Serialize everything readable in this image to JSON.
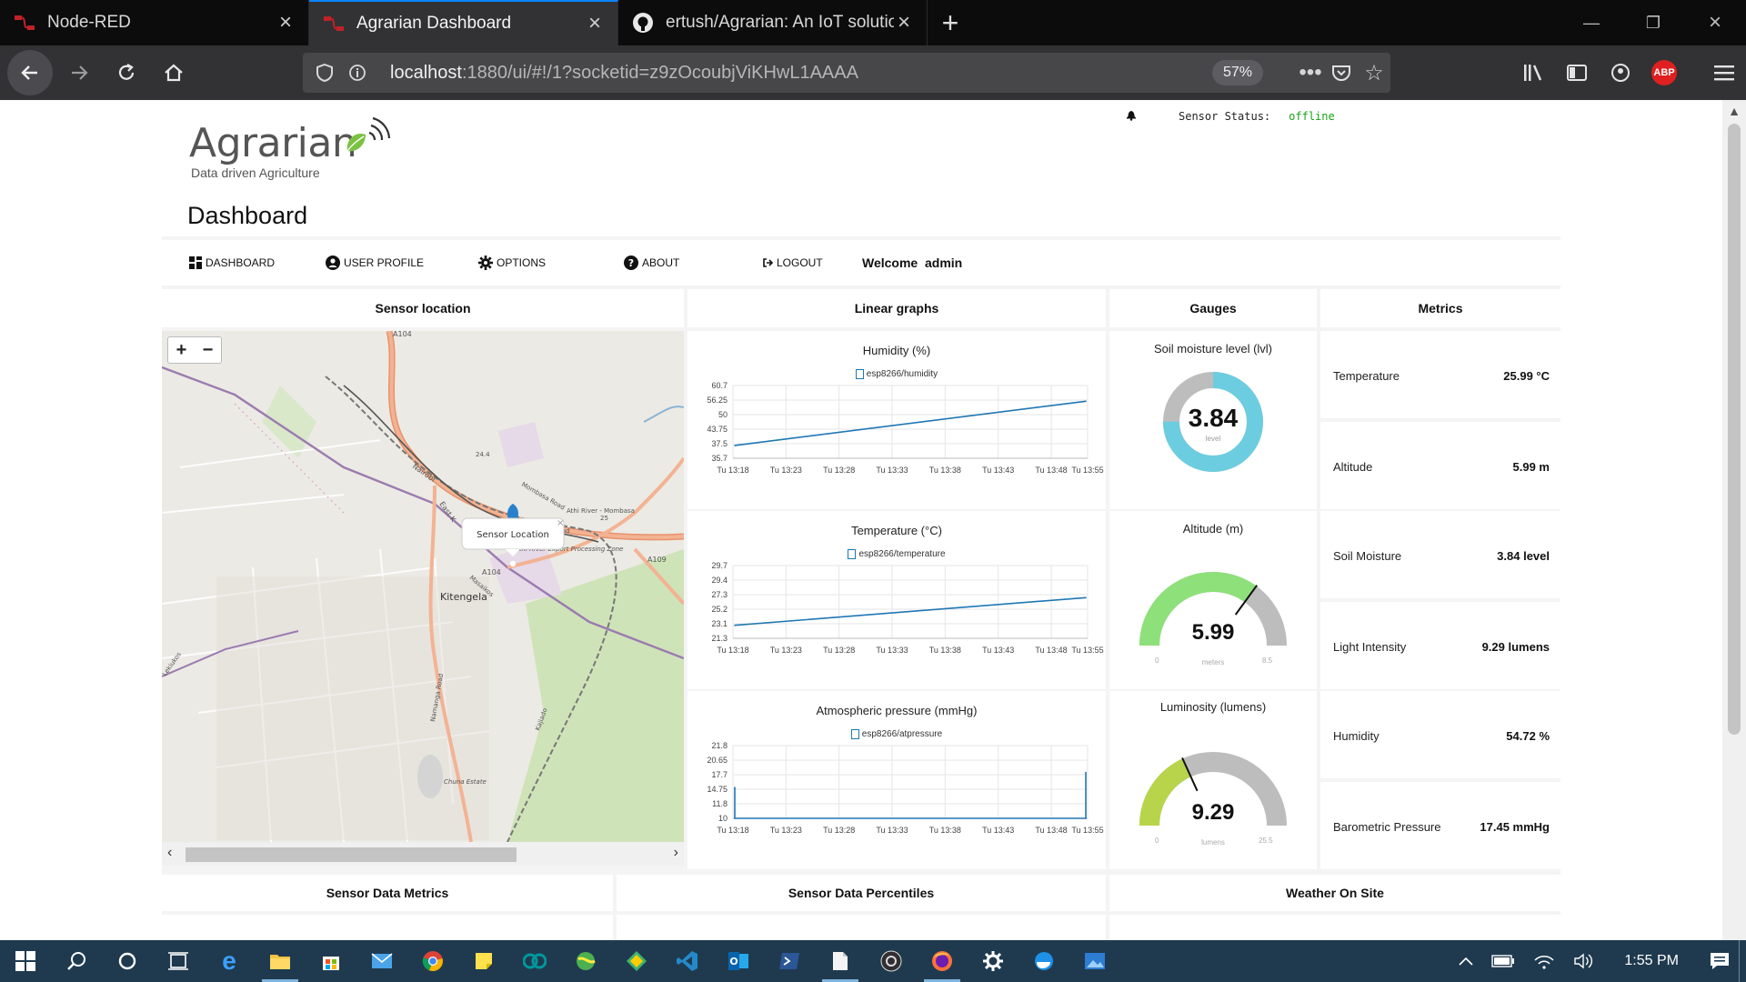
{
  "browser": {
    "tabs": [
      {
        "title": "Node-RED",
        "active": false
      },
      {
        "title": "Agrarian Dashboard",
        "active": true
      },
      {
        "title": "ertush/Agrarian: An IoT solutio",
        "active": false
      }
    ],
    "url_host": "localhost",
    "url_rest": ":1880/ui/#!/1?socketid=z9zOcoubjViKHwL1AAAA",
    "zoom": "57%"
  },
  "header": {
    "brand": "Agrarian",
    "tagline": "Data driven Agriculture",
    "page_title": "Dashboard",
    "status_label": "Sensor Status:",
    "status_value": "offline"
  },
  "menu": {
    "items": [
      "DASHBOARD",
      "USER PROFILE",
      "OPTIONS",
      "ABOUT",
      "LOGOUT"
    ],
    "welcome": "Welcome  admin"
  },
  "columns": {
    "map": "Sensor location",
    "graphs": "Linear graphs",
    "gauges": "Gauges",
    "metrics": "Metrics"
  },
  "bottom_columns": [
    "Sensor Data Metrics",
    "Sensor Data Percentiles",
    "Weather On Site"
  ],
  "map": {
    "popup": "Sensor Location",
    "popup_close": "×",
    "zoom_in": "+",
    "zoom_out": "−",
    "labels": [
      "A104",
      "A104",
      "A109",
      "Kitengela",
      "Nairobi",
      "East K",
      "Mombasa Road",
      "Athi River - Mombasa",
      "Athi River Export Processing Zone",
      "Namanga Road",
      "Kajiado",
      "Chuna Estate",
      "Masaikos",
      "Lekiukos"
    ],
    "labels_small": [
      "24.4",
      "25",
      "ad"
    ]
  },
  "charts": [
    {
      "title": "Humidity (%)",
      "legend": "esp8266/humidity",
      "y_ticks": [
        "60.7",
        "56.25",
        "50",
        "43.75",
        "37.5",
        "35.7"
      ],
      "x_ticks": [
        "Tu 13:18",
        "Tu 13:23",
        "Tu 13:28",
        "Tu 13:33",
        "Tu 13:38",
        "Tu 13:43",
        "Tu 13:48",
        "Tu 13:55"
      ]
    },
    {
      "title": "Temperature (°C)",
      "legend": "esp8266/temperature",
      "y_ticks": [
        "29.7",
        "29.4",
        "27.3",
        "25.2",
        "23.1",
        "21.3"
      ],
      "x_ticks": [
        "Tu 13:18",
        "Tu 13:23",
        "Tu 13:28",
        "Tu 13:33",
        "Tu 13:38",
        "Tu 13:43",
        "Tu 13:48",
        "Tu 13:55"
      ]
    },
    {
      "title": "Atmospheric pressure (mmHg)",
      "legend": "esp8266/atpressure",
      "y_ticks": [
        "21.8",
        "20.65",
        "17.7",
        "14.75",
        "11.8",
        "10"
      ],
      "x_ticks": [
        "Tu 13:18",
        "Tu 13:23",
        "Tu 13:28",
        "Tu 13:33",
        "Tu 13:38",
        "Tu 13:43",
        "Tu 13:48",
        "Tu 13:55"
      ]
    }
  ],
  "gauges": [
    {
      "title": "Soil moisture level (lvl)",
      "value": "3.84",
      "unit": "level",
      "type": "donut",
      "fraction": 0.75
    },
    {
      "title": "Altitude (m)",
      "value": "5.99",
      "unit": "meters",
      "min": "0",
      "max": "8.5",
      "type": "gauge",
      "fraction": 0.7,
      "color": "#8ee07a"
    },
    {
      "title": "Luminosity (lumens)",
      "value": "9.29",
      "unit": "lumens",
      "min": "0",
      "max": "25.5",
      "type": "gauge",
      "fraction": 0.364,
      "color": "#b8d44a"
    }
  ],
  "metrics": [
    {
      "label": "Temperature",
      "value": "25.99 °C"
    },
    {
      "label": "Altitude",
      "value": "5.99 m"
    },
    {
      "label": "Soil Moisture",
      "value": "3.84 level"
    },
    {
      "label": "Light Intensity",
      "value": "9.29 lumens"
    },
    {
      "label": "Humidity",
      "value": "54.72 %"
    },
    {
      "label": "Barometric Pressure",
      "value": "17.45 mmHg"
    }
  ],
  "chart_data": [
    {
      "type": "line",
      "title": "Humidity (%)",
      "x": [
        "Tu 13:18",
        "Tu 13:55"
      ],
      "series": [
        {
          "name": "esp8266/humidity",
          "values": [
            40.1,
            55.3
          ]
        }
      ],
      "ylim": [
        35.7,
        60.7
      ]
    },
    {
      "type": "line",
      "title": "Temperature (°C)",
      "x": [
        "Tu 13:18",
        "Tu 13:55"
      ],
      "series": [
        {
          "name": "esp8266/temperature",
          "values": [
            22.8,
            25.99
          ]
        }
      ],
      "ylim": [
        21.3,
        29.7
      ]
    },
    {
      "type": "line",
      "title": "Atmospheric pressure (mmHg)",
      "x": [
        "Tu 13:18",
        "Tu 13:18",
        "Tu 13:55",
        "Tu 13:55"
      ],
      "series": [
        {
          "name": "esp8266/atpressure",
          "values": [
            15.0,
            10.0,
            10.0,
            17.45
          ]
        }
      ],
      "ylim": [
        10,
        21.8
      ]
    }
  ],
  "taskbar": {
    "time": "1:55 PM"
  },
  "colors": {
    "accent": "#0a84ff",
    "series": "#1f77b4",
    "status_offline": "#19a319",
    "donut_fill": "#6ccde0",
    "gauge_track": "#bdbdbd"
  }
}
